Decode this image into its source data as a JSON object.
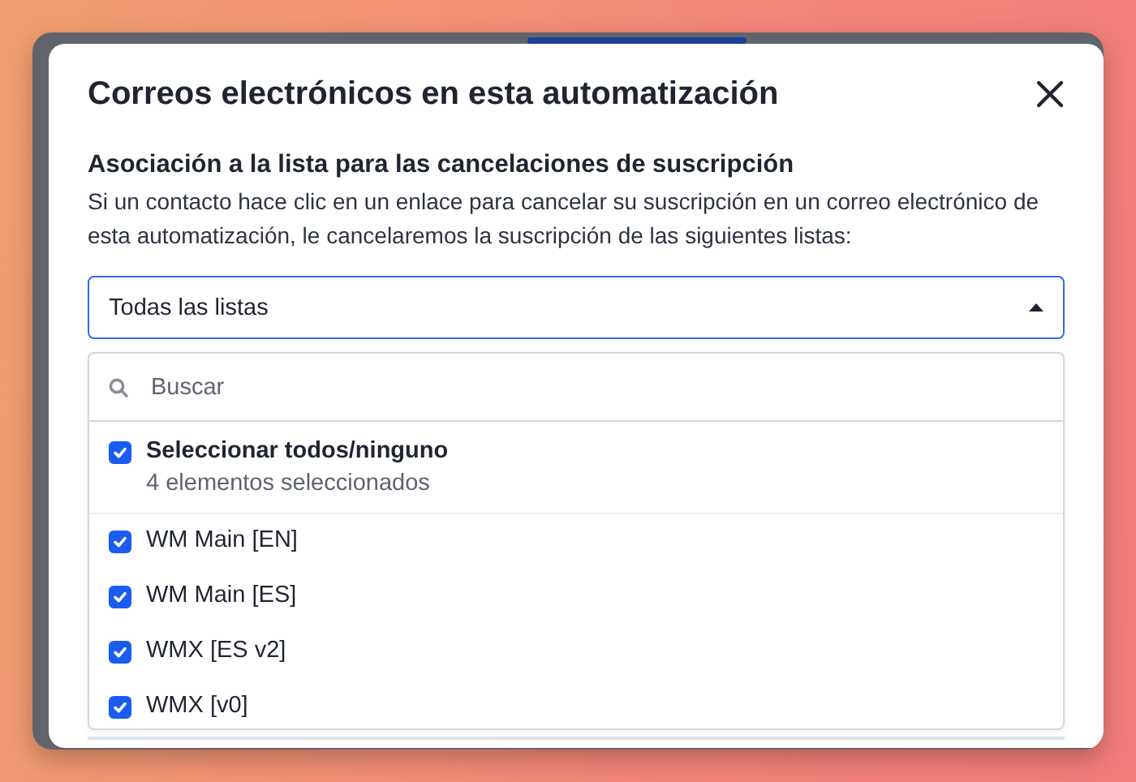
{
  "modal": {
    "title": "Correos electrónicos en esta automatización",
    "section": {
      "heading": "Asociación a la lista para las cancelaciones de suscripción",
      "description": "Si un contacto hace clic en un enlace para cancelar su suscripción en un correo electrónico de esta automatización, le cancelaremos la suscripción de las siguientes listas:"
    },
    "select": {
      "value": "Todas las listas",
      "expanded": true
    },
    "dropdown": {
      "search": {
        "placeholder": "Buscar"
      },
      "select_all": {
        "label": "Seleccionar todos/ninguno",
        "count": "4 elementos seleccionados",
        "checked": true
      },
      "items": [
        {
          "label": "WM Main [EN]",
          "checked": true
        },
        {
          "label": "WM Main [ES]",
          "checked": true
        },
        {
          "label": "WMX [ES v2]",
          "checked": true
        },
        {
          "label": "WMX [v0]",
          "checked": true
        }
      ]
    }
  }
}
